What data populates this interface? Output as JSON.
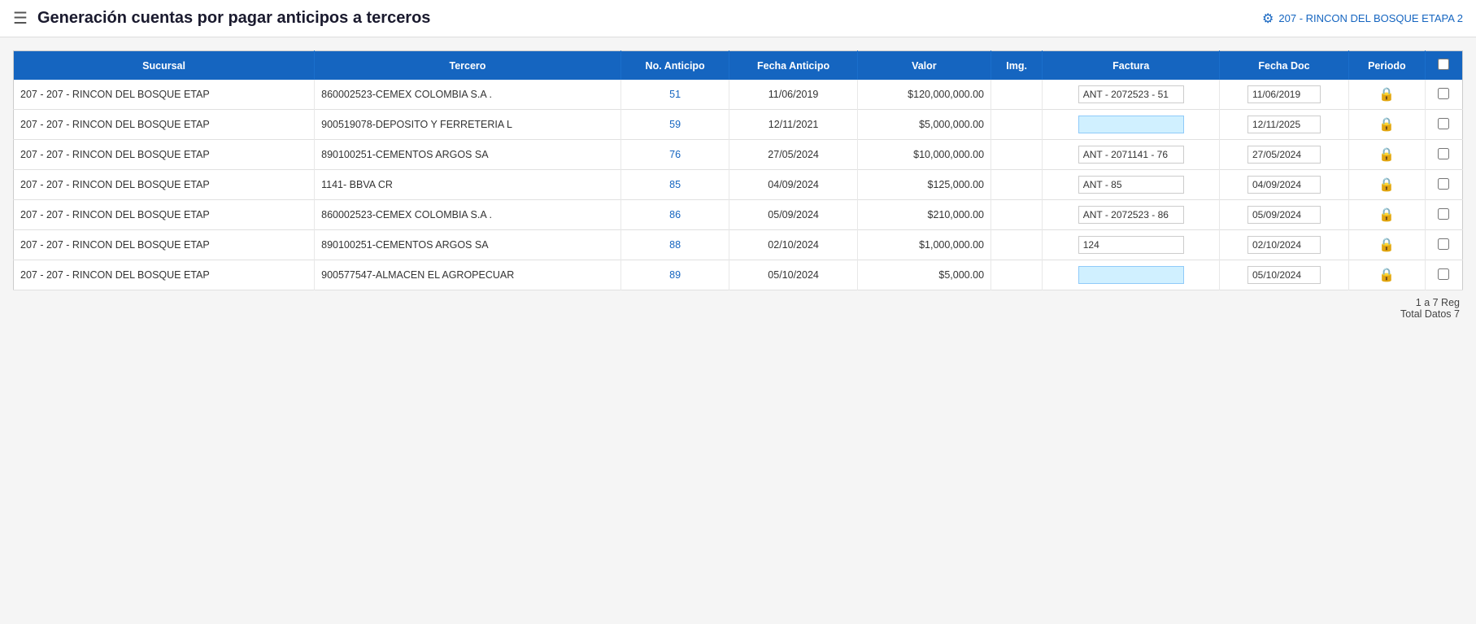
{
  "header": {
    "menu_icon": "☰",
    "title": "Generación cuentas por pagar anticipos a terceros",
    "gear_icon": "⚙",
    "company": "207 - RINCON DEL BOSQUE ETAPA 2"
  },
  "table": {
    "columns": [
      "Sucursal",
      "Tercero",
      "No. Anticipo",
      "Fecha Anticipo",
      "Valor",
      "Img.",
      "Factura",
      "Fecha Doc",
      "Periodo",
      ""
    ],
    "rows": [
      {
        "sucursal": "207 - 207 - RINCON DEL BOSQUE ETAP",
        "tercero": "860002523-CEMEX COLOMBIA S.A .",
        "no_anticipo": "51",
        "fecha_anticipo": "11/06/2019",
        "valor": "$120,000,000.00",
        "factura": "ANT - 2072523 - 51",
        "factura_highlighted": false,
        "fecha_doc": "11/06/2019",
        "lock_color": "green",
        "checked": false
      },
      {
        "sucursal": "207 - 207 - RINCON DEL BOSQUE ETAP",
        "tercero": "900519078-DEPOSITO Y FERRETERIA L",
        "no_anticipo": "59",
        "fecha_anticipo": "12/11/2021",
        "valor": "$5,000,000.00",
        "factura": "",
        "factura_highlighted": true,
        "fecha_doc": "12/11/2025",
        "lock_color": "red",
        "checked": false
      },
      {
        "sucursal": "207 - 207 - RINCON DEL BOSQUE ETAP",
        "tercero": "890100251-CEMENTOS ARGOS SA",
        "no_anticipo": "76",
        "fecha_anticipo": "27/05/2024",
        "valor": "$10,000,000.00",
        "factura": "ANT - 2071141 - 76",
        "factura_highlighted": false,
        "fecha_doc": "27/05/2024",
        "lock_color": "green",
        "checked": false
      },
      {
        "sucursal": "207 - 207 - RINCON DEL BOSQUE ETAP",
        "tercero": "1141- BBVA CR",
        "no_anticipo": "85",
        "fecha_anticipo": "04/09/2024",
        "valor": "$125,000.00",
        "factura": "ANT - 85",
        "factura_highlighted": false,
        "fecha_doc": "04/09/2024",
        "lock_color": "green",
        "checked": false
      },
      {
        "sucursal": "207 - 207 - RINCON DEL BOSQUE ETAP",
        "tercero": "860002523-CEMEX COLOMBIA S.A .",
        "no_anticipo": "86",
        "fecha_anticipo": "05/09/2024",
        "valor": "$210,000.00",
        "factura": "ANT - 2072523 - 86",
        "factura_highlighted": false,
        "fecha_doc": "05/09/2024",
        "lock_color": "green",
        "checked": false
      },
      {
        "sucursal": "207 - 207 - RINCON DEL BOSQUE ETAP",
        "tercero": "890100251-CEMENTOS ARGOS SA",
        "no_anticipo": "88",
        "fecha_anticipo": "02/10/2024",
        "valor": "$1,000,000.00",
        "factura": "124",
        "factura_highlighted": false,
        "fecha_doc": "02/10/2024",
        "lock_color": "green",
        "checked": false
      },
      {
        "sucursal": "207 - 207 - RINCON DEL BOSQUE ETAP",
        "tercero": "900577547-ALMACEN EL AGROPECUAR",
        "no_anticipo": "89",
        "fecha_anticipo": "05/10/2024",
        "valor": "$5,000.00",
        "factura": "",
        "factura_highlighted": true,
        "fecha_doc": "05/10/2024",
        "lock_color": "green",
        "checked": false
      }
    ],
    "pagination": {
      "range": "1 a 7 Reg",
      "total": "Total Datos 7"
    }
  }
}
